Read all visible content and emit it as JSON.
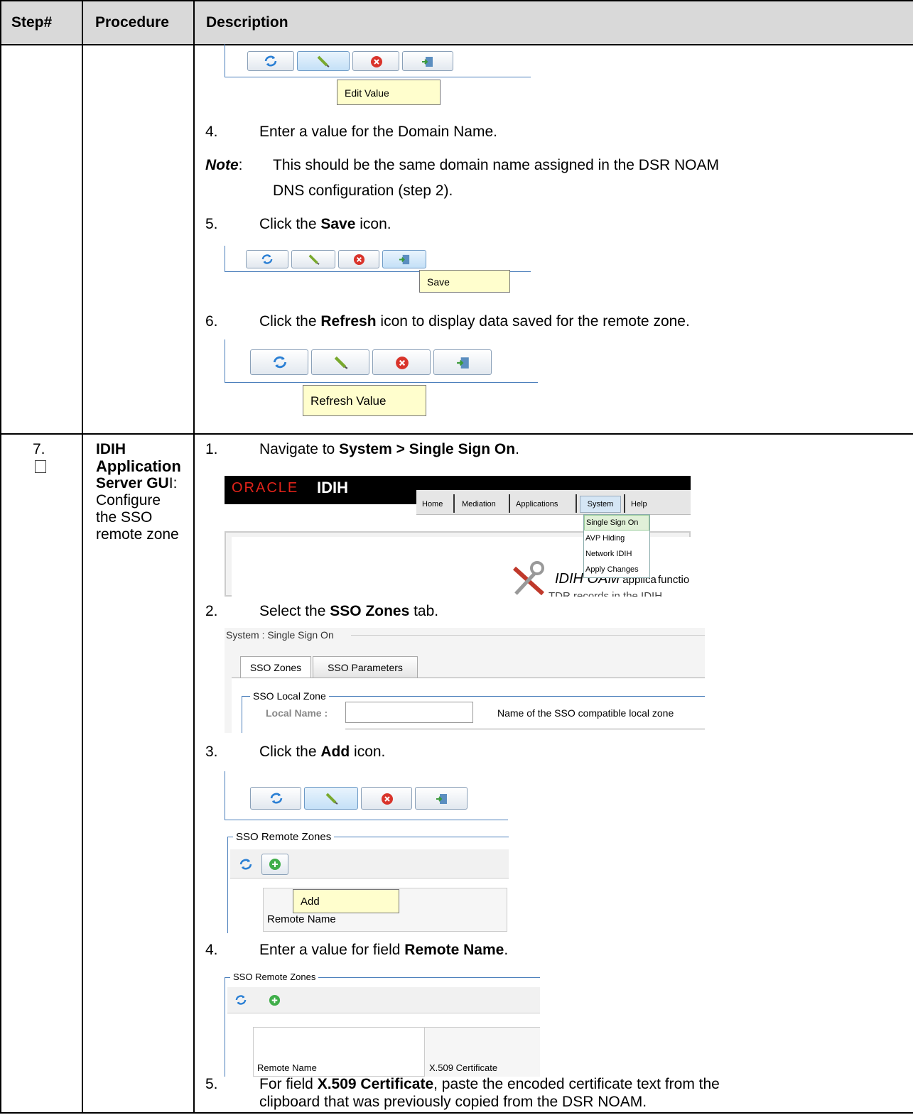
{
  "table": {
    "headers": {
      "step": "Step#",
      "procedure": "Procedure",
      "description": "Description"
    }
  },
  "top": {
    "tooltip_edit": "Edit Value",
    "item4": {
      "num": "4.",
      "text": "Enter a value for the Domain Name."
    },
    "note": {
      "label": "Note",
      "colon": ":",
      "line1": "This should be the same domain name assigned in the DSR NOAM",
      "line2": "DNS configuration (step 2)."
    },
    "item5": {
      "num": "5.",
      "pre": "Click the ",
      "bold": "Save",
      "post": " icon."
    },
    "tooltip_save": "Save",
    "item6": {
      "num": "6.",
      "pre": "Click the ",
      "bold": "Refresh",
      "post": " icon to display data saved for the remote zone."
    },
    "tooltip_refresh": "Refresh Value"
  },
  "step7": {
    "number": "7.",
    "procedure": {
      "line1": "IDIH",
      "line2": "Application",
      "line3": "Server GU",
      "line3_end": "I",
      "line3_colon": ":",
      "line4": "Configure",
      "line5": "the SSO",
      "line6": "remote zone"
    },
    "item1": {
      "num": "1.",
      "pre": "Navigate to ",
      "bold": "System > Single Sign On",
      "post": "."
    },
    "oracle": {
      "logo": "ORACLE",
      "product": "IDIH",
      "menu": [
        "Home",
        "Mediation",
        "Applications",
        "System",
        "Help"
      ],
      "dropdown": [
        "Single Sign On",
        "AVP Hiding",
        "Network IDIH",
        "Apply Changes"
      ],
      "oam_title": "IDIH OAM",
      "oam_text1": " applica",
      "oam_text2": "functio",
      "oam_text3": "TDR records in the IDIH ProTrace applicati"
    },
    "item2": {
      "num": "2.",
      "pre": "Select the ",
      "bold": "SSO Zones",
      "post": " tab."
    },
    "sso": {
      "title": "System : Single Sign On",
      "tabs": [
        "SSO Zones",
        "SSO Parameters"
      ],
      "local_zone": "SSO Local Zone",
      "local_name_label": "Local Name :",
      "local_name_value": "",
      "local_name_help": "Name of the SSO compatible local zone"
    },
    "item3": {
      "num": "3.",
      "pre": "Click the ",
      "bold": "Add",
      "post": " icon."
    },
    "remote1": {
      "title": "SSO Remote Zones",
      "tooltip_add": "Add",
      "col_remote": "Remote Name"
    },
    "item4": {
      "num": "4.",
      "pre": "Enter a value for field ",
      "bold": "Remote Name",
      "post": "."
    },
    "remote2": {
      "title": "SSO Remote Zones",
      "col_remote": "Remote Name",
      "col_cert": "X.509 Certificate",
      "remote_value": ""
    },
    "item5": {
      "num": "5.",
      "pre": "For field ",
      "bold": "X.509 Certificate",
      "post": ", paste the encoded certificate text from the",
      "line2": "clipboard that was previously copied from the DSR NOAM."
    }
  },
  "colors": {
    "header_bg": "#d9d9d9",
    "tooltip_bg": "#fffecd",
    "accent_blue": "#4a7ebb",
    "oracle_red": "#e2231a"
  },
  "icons": [
    "refresh-icon",
    "edit-pencil-icon",
    "cancel-icon",
    "save-icon",
    "add-icon",
    "tools-icon",
    "checkbox-icon"
  ]
}
